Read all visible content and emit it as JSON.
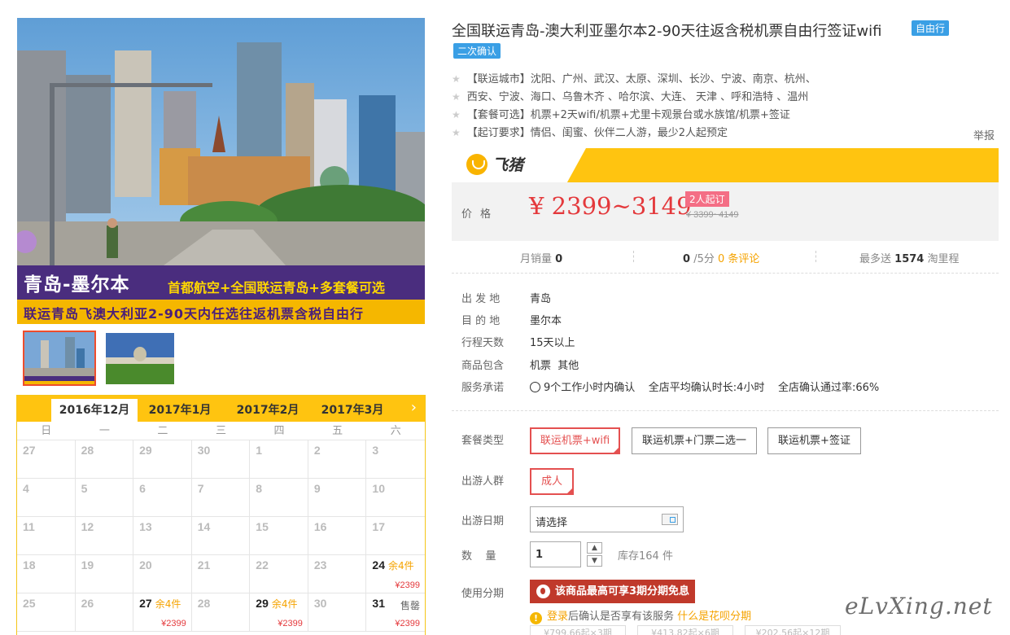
{
  "hero": {
    "title": "青岛-墨尔本",
    "subtitle": "首都航空+全国联运青岛+多套餐可选",
    "caption": "联运青岛飞澳大利亚2-90天内任选往返机票含税自由行"
  },
  "calendar": {
    "tabs": [
      "2016年12月",
      "2017年1月",
      "2017年2月",
      "2017年3月"
    ],
    "weekdays": [
      "日",
      "一",
      "二",
      "三",
      "四",
      "五",
      "六"
    ],
    "days": [
      {
        "d": "27"
      },
      {
        "d": "28"
      },
      {
        "d": "29"
      },
      {
        "d": "30"
      },
      {
        "d": "1"
      },
      {
        "d": "2"
      },
      {
        "d": "3"
      },
      {
        "d": "4"
      },
      {
        "d": "5"
      },
      {
        "d": "6"
      },
      {
        "d": "7"
      },
      {
        "d": "8"
      },
      {
        "d": "9"
      },
      {
        "d": "10"
      },
      {
        "d": "11"
      },
      {
        "d": "12"
      },
      {
        "d": "13"
      },
      {
        "d": "14"
      },
      {
        "d": "15"
      },
      {
        "d": "16"
      },
      {
        "d": "17"
      },
      {
        "d": "18"
      },
      {
        "d": "19"
      },
      {
        "d": "20"
      },
      {
        "d": "21"
      },
      {
        "d": "22"
      },
      {
        "d": "23"
      },
      {
        "d": "24",
        "stock": "余4件",
        "price": "¥2399"
      },
      {
        "d": "25"
      },
      {
        "d": "26"
      },
      {
        "d": "27",
        "stock": "余4件",
        "price": "¥2399"
      },
      {
        "d": "28"
      },
      {
        "d": "29",
        "stock": "余4件",
        "price": "¥2399"
      },
      {
        "d": "30"
      },
      {
        "d": "31",
        "sold": "售罄",
        "price": "¥2399"
      }
    ]
  },
  "product": {
    "title": "全国联运青岛-澳大利亚墨尔本2-90天往返含税机票自由行签证wifi",
    "tag1": "自由行",
    "tag2": "二次确认",
    "features": [
      "【联运城市】沈阳、广州、武汉、太原、深圳、长沙、宁波、南京、杭州、",
      "西安、宁波、海口、乌鲁木齐 、哈尔滨、大连、 天津 、呼和浩特 、温州",
      "【套餐可选】机票+2天wifi/机票+尤里卡观景台或水族馆/机票+签证",
      "【起订要求】情侣、闺蜜、伙伴二人游，最少2人起预定"
    ],
    "report": "举报"
  },
  "brand": {
    "name": "飞猪",
    "accent": "#ffc410"
  },
  "price": {
    "label": "价格",
    "current": "¥ 2399~3149",
    "min_tag": "2人起订",
    "original": "¥ 3399~4149"
  },
  "stats": {
    "monthly_label": "月销量",
    "monthly_value": "0",
    "rating_value": "0",
    "rating_suffix": "/5分",
    "reviews": "0 条评论",
    "points_prefix": "最多送",
    "points_value": "1574",
    "points_suffix": "淘里程"
  },
  "info": [
    {
      "k": "出 发 地",
      "v": "青岛"
    },
    {
      "k": "目 的 地",
      "v": "墨尔本"
    },
    {
      "k": "行程天数",
      "v": "15天以上"
    },
    {
      "k": "商品包含",
      "v": "机票  其他"
    },
    {
      "k": "服务承诺",
      "v": "9个工作小时内确认    全店平均确认时长:4小时    全店确认通过率:66%"
    }
  ],
  "options": {
    "package_label": "套餐类型",
    "packages": [
      "联运机票+wifi",
      "联运机票+门票二选一",
      "联运机票+签证"
    ],
    "crowd_label": "出游人群",
    "crowd": "成人",
    "date_label": "出游日期",
    "date_placeholder": "请选择",
    "qty_label": "数    量",
    "qty": "1",
    "stock": "库存164 件",
    "install_label": "使用分期",
    "install_btn": "该商品最高可享3期分期免息",
    "note_login": "登录",
    "note_text": "后确认是否享有该服务",
    "note_link": "什么是花呗分期",
    "plans": [
      "¥799.66起×3期",
      "¥413.82起×6期",
      "¥202.56起×12期"
    ]
  },
  "watermark": "eLvXing.net"
}
